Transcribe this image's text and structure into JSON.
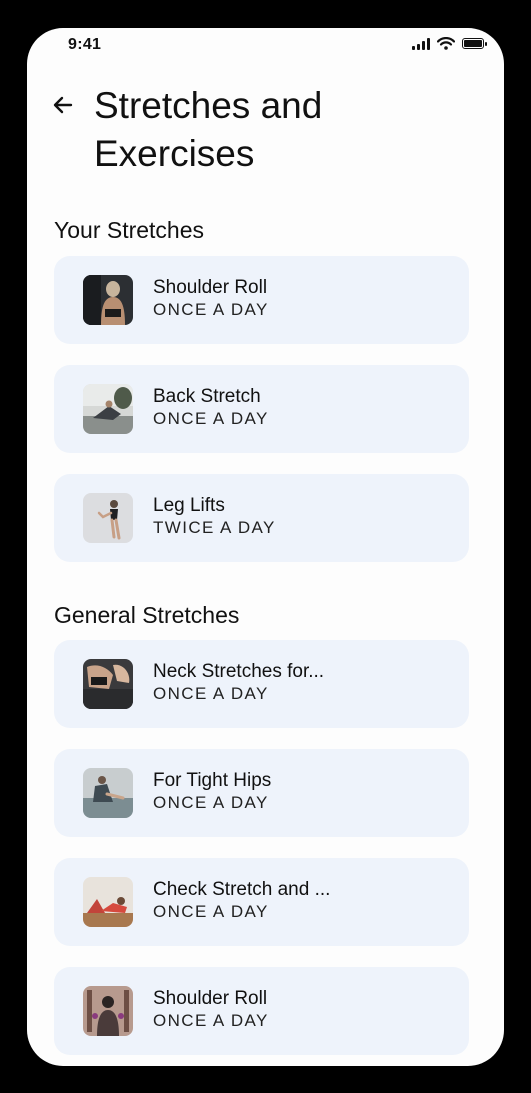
{
  "status_bar": {
    "time": "9:41"
  },
  "header": {
    "title": "Stretches and Exercises"
  },
  "sections": [
    {
      "heading": "Your Stretches",
      "items": [
        {
          "name": "Shoulder Roll",
          "frequency": "ONCE A DAY",
          "thumb": "woman-back-photo"
        },
        {
          "name": "Back Stretch",
          "frequency": "ONCE A DAY",
          "thumb": "living-room-stretch-photo"
        },
        {
          "name": "Leg Lifts",
          "frequency": "TWICE A DAY",
          "thumb": "leg-lift-photo"
        }
      ]
    },
    {
      "heading": "General Stretches",
      "items": [
        {
          "name": "Neck Stretches for...",
          "frequency": "ONCE A DAY",
          "thumb": "neck-stretch-photo"
        },
        {
          "name": "For Tight Hips",
          "frequency": "ONCE A DAY",
          "thumb": "hip-stretch-photo"
        },
        {
          "name": "Check Stretch and ...",
          "frequency": "ONCE A DAY",
          "thumb": "floor-stretch-photo"
        },
        {
          "name": "Shoulder Roll",
          "frequency": "ONCE A DAY",
          "thumb": "gym-back-photo"
        }
      ]
    }
  ]
}
